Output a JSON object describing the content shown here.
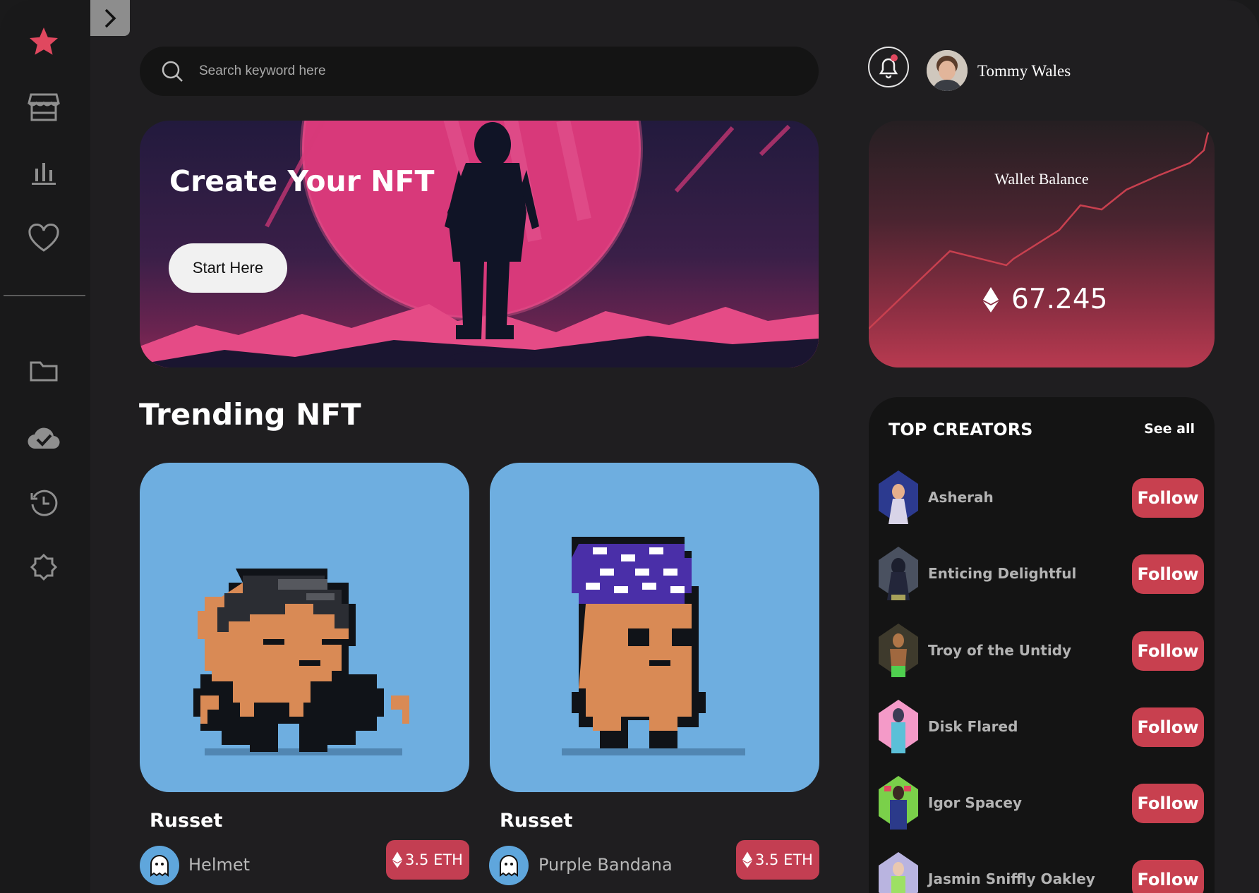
{
  "search": {
    "placeholder": "Search keyword here"
  },
  "header": {
    "username": "Tommy Wales",
    "notification_icon": "bell-icon"
  },
  "sidebar": {
    "items": [
      {
        "icon": "star-icon",
        "active": true
      },
      {
        "icon": "store-icon"
      },
      {
        "icon": "bar-chart-icon"
      },
      {
        "icon": "heart-icon"
      },
      {
        "icon": "folder-icon"
      },
      {
        "icon": "cloud-check-icon"
      },
      {
        "icon": "history-icon"
      },
      {
        "icon": "settings-icon"
      }
    ],
    "accent": "#e0485f"
  },
  "banner": {
    "title": "Create Your NFT",
    "button_label": "Start Here"
  },
  "wallet": {
    "title": "Wallet Balance",
    "value": "67.245",
    "currency_icon": "ethereum-icon"
  },
  "trending": {
    "title": "Trending NFT",
    "cards": [
      {
        "name": "Russet",
        "owner": "Helmet",
        "price": "3.5 ETH"
      },
      {
        "name": "Russet",
        "owner": "Purple Bandana",
        "price": "3.5 ETH"
      }
    ]
  },
  "creators": {
    "title": "TOP CREATORS",
    "see_all": "See all",
    "follow_label": "Follow",
    "items": [
      {
        "name": "Asherah"
      },
      {
        "name": "Enticing Delightful"
      },
      {
        "name": "Troy of the Untidy"
      },
      {
        "name": "Disk Flared"
      },
      {
        "name": "Igor Spacey"
      },
      {
        "name": "Jasmin Sniffly Oakley"
      }
    ]
  },
  "colors": {
    "background": "#1f1e20",
    "accent": "#c8404f",
    "card": "#6eaee0"
  }
}
